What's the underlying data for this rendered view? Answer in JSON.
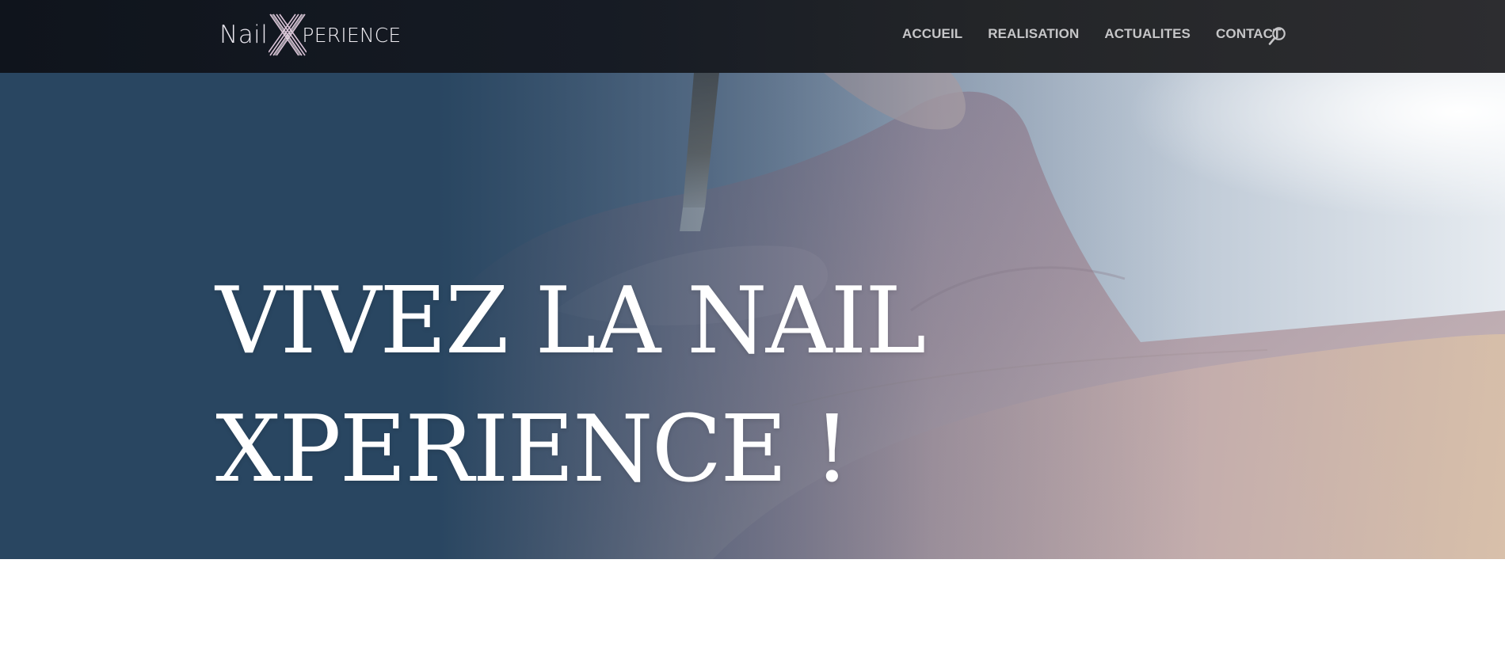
{
  "header": {
    "logo": {
      "part_nail": "Nail",
      "part_x": "X",
      "part_rest": "PERIENCE"
    },
    "nav": [
      {
        "label": "ACCUEIL"
      },
      {
        "label": "REALISATION"
      },
      {
        "label": "ACTUALITES"
      },
      {
        "label": "CONTACT"
      }
    ],
    "search_icon": "search-icon"
  },
  "hero": {
    "title_line1": "VIVEZ LA NAIL",
    "title_line2": "XPERIENCE !",
    "background": "nail-painting-photo"
  },
  "colors": {
    "header_bg": "#14181f",
    "nav_text": "#c6c6c8",
    "hero_overlay": "#294661",
    "hero_text": "#ffffff",
    "logo_accent": "#c9a8c4",
    "page_bg": "#ffffff"
  }
}
